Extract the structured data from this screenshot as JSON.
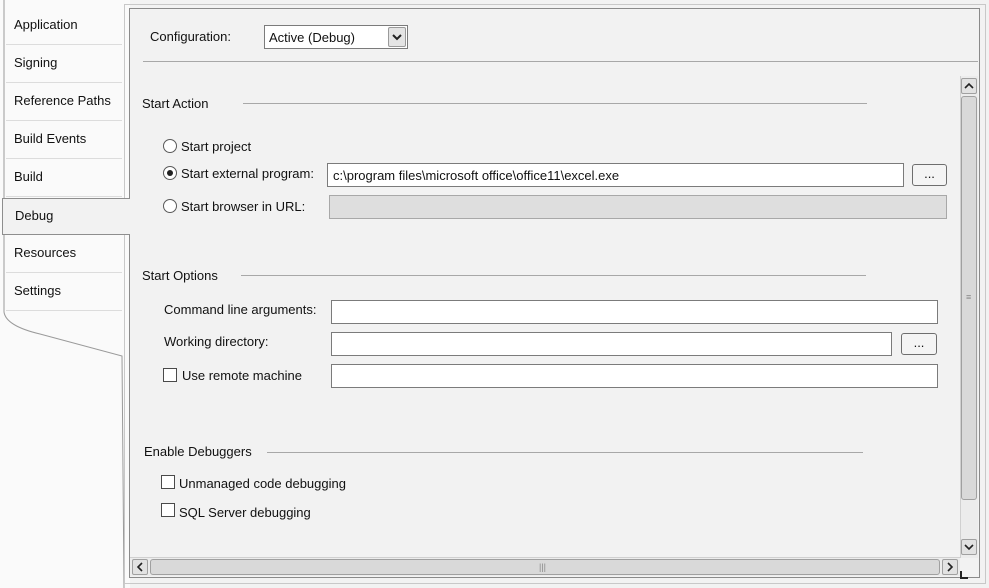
{
  "tabs": [
    {
      "label": "Application"
    },
    {
      "label": "Signing"
    },
    {
      "label": "Reference Paths"
    },
    {
      "label": "Build Events"
    },
    {
      "label": "Build"
    },
    {
      "label": "Debug",
      "selected": true
    },
    {
      "label": "Resources"
    },
    {
      "label": "Settings"
    }
  ],
  "header": {
    "configuration_label": "Configuration:",
    "configuration_value": "Active (Debug)"
  },
  "start_action": {
    "title": "Start Action",
    "start_project_label": "Start project",
    "start_external_label": "Start external program:",
    "start_external_value": "c:\\program files\\microsoft office\\office11\\excel.exe",
    "browse_label": "...",
    "start_browser_label": "Start browser in URL:",
    "selected": "start_external"
  },
  "start_options": {
    "title": "Start Options",
    "cmd_args_label": "Command line arguments:",
    "cmd_args_value": "",
    "working_dir_label": "Working directory:",
    "working_dir_value": "",
    "browse_label": "...",
    "remote_label": "Use remote machine",
    "remote_value": ""
  },
  "enable_debuggers": {
    "title": "Enable Debuggers",
    "unmanaged_label": "Unmanaged code debugging",
    "sql_label": "SQL Server debugging"
  },
  "icons": {
    "combo": "chevron-down-icon",
    "scroll_up": "triangle-up-icon",
    "scroll_down": "triangle-down-icon",
    "scroll_left": "triangle-left-icon",
    "scroll_right": "triangle-right-icon"
  }
}
